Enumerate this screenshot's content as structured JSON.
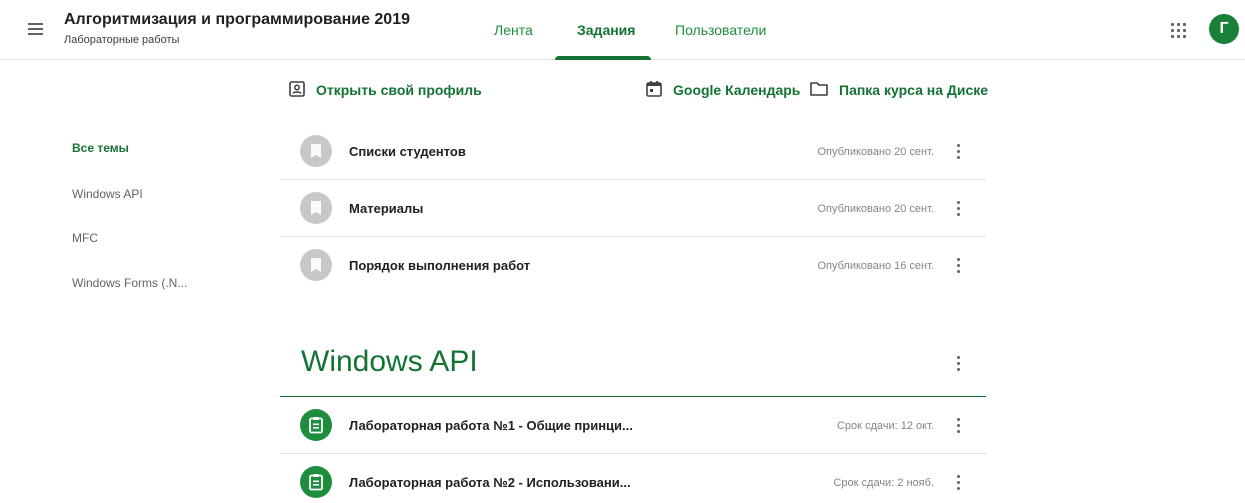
{
  "header": {
    "class_title": "Алгоритмизация и программирование 2019",
    "class_subtitle": "Лабораторные работы",
    "tabs": [
      {
        "label": "Лента"
      },
      {
        "label": "Задания",
        "active": true
      },
      {
        "label": "Пользователи"
      }
    ],
    "avatar_letter": "Г"
  },
  "actions": {
    "profile": "Открыть свой профиль",
    "calendar": "Google Календарь",
    "drive": "Папка курса на Диске"
  },
  "topics": [
    "Все темы",
    "Windows API",
    "MFC",
    "Windows Forms (.N..."
  ],
  "materials": [
    {
      "title": "Списки студентов",
      "meta": "Опубликовано 20 сент."
    },
    {
      "title": "Материалы",
      "meta": "Опубликовано 20 сент."
    },
    {
      "title": "Порядок выполнения работ",
      "meta": "Опубликовано 16 сент."
    }
  ],
  "section": {
    "title": "Windows API",
    "assignments": [
      {
        "title": "Лабораторная работа №1 - Общие принци...",
        "meta": "Срок сдачи: 12 окт."
      },
      {
        "title": "Лабораторная работа №2 - Использовани...",
        "meta": "Срок сдачи: 2 нояб."
      }
    ]
  },
  "colors": {
    "accent": "#137333",
    "assignment_icon": "#1e8e3e",
    "material_icon": "#c8c8c8"
  },
  "icons": [
    "menu-icon",
    "apps-icon",
    "profile-icon",
    "calendar-icon",
    "folder-icon",
    "material-icon",
    "assignment-icon",
    "more-vert-icon"
  ]
}
